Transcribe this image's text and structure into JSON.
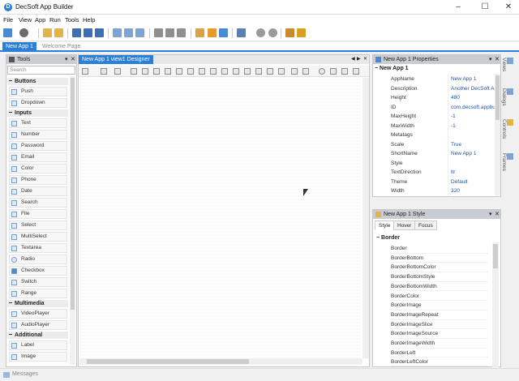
{
  "window": {
    "title": "DecSoft App Builder",
    "minimize": "–",
    "maximize": "☐",
    "close": "✕"
  },
  "menu": [
    "File",
    "View",
    "App",
    "Run",
    "Tools",
    "Help"
  ],
  "doc_tabs": {
    "active": "New App 1",
    "inactive": "Welcome Page"
  },
  "tools_panel": {
    "title": "Tools",
    "search_placeholder": "Search",
    "sections": [
      {
        "name": "Buttons",
        "items": [
          "Push",
          "Dropdown"
        ]
      },
      {
        "name": "Inputs",
        "items": [
          "Text",
          "Number",
          "Password",
          "Email",
          "Color",
          "Phone",
          "Date",
          "Search",
          "File",
          "Select",
          "MultiSelect",
          "Textarea",
          "Radio",
          "Checkbox",
          "Switch",
          "Range"
        ]
      },
      {
        "name": "Multimedia",
        "items": [
          "VideoPlayer",
          "AudioPlayer"
        ]
      },
      {
        "name": "Additional",
        "items": [
          "Label",
          "Image"
        ]
      }
    ]
  },
  "designer": {
    "tab_label": "New App 1 view1 Designer",
    "nav_left": "◀",
    "nav_right": "▶",
    "close": "✕"
  },
  "properties_panel": {
    "title": "New App 1 Properties",
    "group": "New App 1",
    "rows": [
      {
        "name": "AppName",
        "value": "New App 1"
      },
      {
        "name": "Description",
        "value": "Another DecSoft App Builder"
      },
      {
        "name": "Height",
        "value": "480"
      },
      {
        "name": "ID",
        "value": "com.decsoft.appbuilder"
      },
      {
        "name": "MaxHeight",
        "value": "-1"
      },
      {
        "name": "MaxWidth",
        "value": "-1"
      },
      {
        "name": "Metatags",
        "value": ""
      },
      {
        "name": "Scale",
        "value": "True"
      },
      {
        "name": "ShortName",
        "value": "New App 1"
      },
      {
        "name": "Style",
        "value": ""
      },
      {
        "name": "TextDirection",
        "value": "ltr"
      },
      {
        "name": "Theme",
        "value": "Default"
      },
      {
        "name": "Width",
        "value": "320"
      }
    ]
  },
  "style_panel": {
    "title": "New App 1 Style",
    "tabs": [
      "Style",
      "Hover",
      "Focus"
    ],
    "group": "Border",
    "rows": [
      "Border",
      "BorderBottom",
      "BorderBottomColor",
      "BorderBottomStyle",
      "BorderBottomWidth",
      "BorderColor",
      "BorderImage",
      "BorderImageRepeat",
      "BorderImageSlice",
      "BorderImageSource",
      "BorderImageWidth",
      "BorderLeft",
      "BorderLeftColor"
    ]
  },
  "right_tabs": [
    "Views",
    "Dialogs",
    "Controls",
    "Frames"
  ],
  "status": {
    "messages": "Messages"
  },
  "colors": {
    "accent": "#2b7fd6",
    "panel_header": "#c9ccd1",
    "value_text": "#2254a3"
  }
}
